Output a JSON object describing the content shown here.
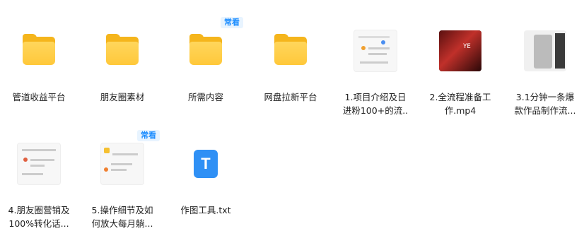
{
  "items": [
    {
      "name": "管道收益平台",
      "type": "folder",
      "badge": ""
    },
    {
      "name": "朋友圈素材",
      "type": "folder",
      "badge": ""
    },
    {
      "name": "所需内容",
      "type": "folder",
      "badge": "常看"
    },
    {
      "name": "网盘拉新平台",
      "type": "folder",
      "badge": ""
    },
    {
      "name": "1.项目介绍及日\n进粉100+的流..",
      "type": "mindmap",
      "badge": ""
    },
    {
      "name": "2.全流程准备工\n作.mp4",
      "type": "video",
      "badge": ""
    },
    {
      "name": "3.1分钟一条爆\n款作品制作流...",
      "type": "phone",
      "badge": ""
    },
    {
      "name": "4.朋友圈营销及\n100%转化话...",
      "type": "mindmap",
      "badge": ""
    },
    {
      "name": "5.操作细节及如\n何放大每月躺...",
      "type": "mindmap",
      "badge": "常看"
    },
    {
      "name": "作图工具.txt",
      "type": "txt",
      "badge": "",
      "icon_letter": "T"
    }
  ],
  "colors": {
    "folder": "#ffc83a",
    "badge_text": "#1a8cff",
    "txt_icon": "#2f90f5"
  }
}
